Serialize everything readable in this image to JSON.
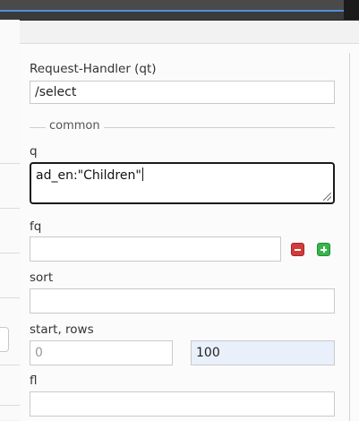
{
  "form": {
    "request_handler": {
      "label": "Request-Handler (qt)",
      "value": "/select"
    },
    "section_legend": "common",
    "q": {
      "label": "q",
      "value": "ad_en:\"Children\""
    },
    "fq": {
      "label": "fq",
      "value": ""
    },
    "sort": {
      "label": "sort",
      "value": ""
    },
    "start_rows": {
      "label": "start, rows",
      "start_placeholder": "0",
      "rows_value": "100"
    },
    "fl": {
      "label": "fl",
      "value": ""
    }
  },
  "icons": {
    "remove": "minus-icon",
    "add": "plus-icon"
  },
  "colors": {
    "accent": "#4f8fd8",
    "remove": "#d33b3b",
    "add": "#38b54a",
    "rows_bg": "#e9f0fb"
  }
}
